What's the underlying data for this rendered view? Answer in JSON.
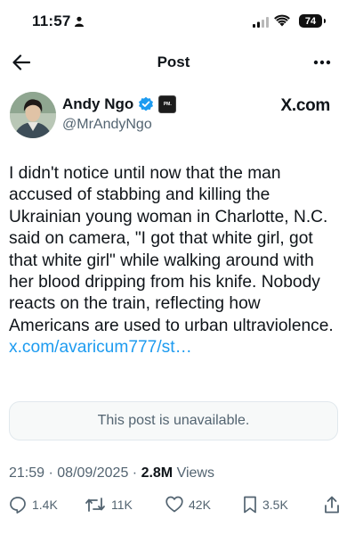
{
  "status_bar": {
    "time": "11:57",
    "battery": "74"
  },
  "nav": {
    "title": "Post"
  },
  "author": {
    "name": "Andy Ngo",
    "handle": "@MrAndyNgo",
    "affiliate_badge": "PM.",
    "source_logo": "X.com"
  },
  "post": {
    "text": "I didn't notice until now that the man accused of stabbing and killing the Ukrainian young woman in Charlotte, N.C. said on camera, \"I got that white girl, got that white girl\" while walking around with her blood dripping from his knife. Nobody reacts on the train, reflecting how Americans are used to urban ultraviolence.",
    "link": "x.com/avaricum777/st…",
    "unavailable": "This post is unavailable."
  },
  "meta": {
    "time": "21:59",
    "date": "08/09/2025",
    "views_count": "2.8M",
    "views_label": "Views"
  },
  "actions": {
    "replies": "1.4K",
    "reposts": "11K",
    "likes": "42K",
    "bookmarks": "3.5K"
  },
  "colors": {
    "accent": "#1d9bf0",
    "secondary_text": "#536471",
    "primary_text": "#0f1419"
  }
}
